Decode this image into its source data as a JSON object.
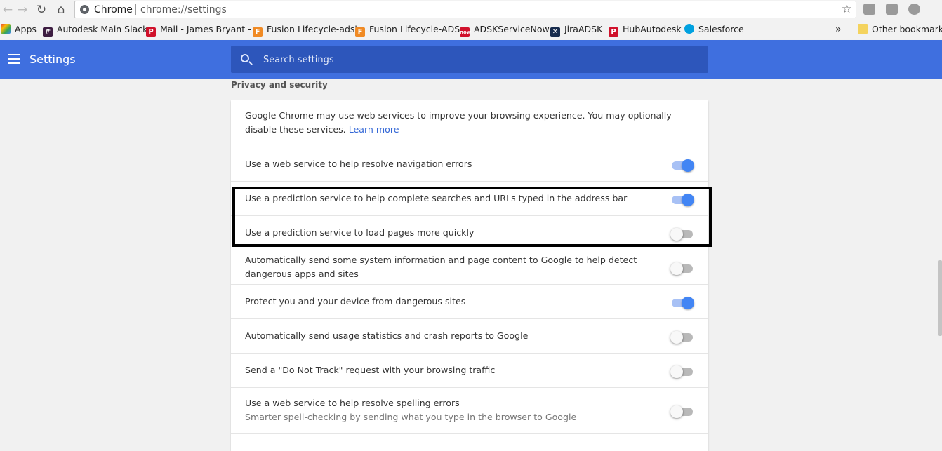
{
  "browser": {
    "origin": "Chrome",
    "url": "chrome://settings",
    "bookmarks": [
      {
        "label": "Apps",
        "icon": "apps-grid-icon",
        "color": "#e94235"
      },
      {
        "label": "Autodesk Main Slack",
        "icon": "hash-icon",
        "color": "#3d1d41"
      },
      {
        "label": "Mail - James Bryant -",
        "icon": "mail-icon",
        "color": "#d0112b"
      },
      {
        "label": "Fusion Lifecycle-adsk",
        "icon": "fusion-icon",
        "color": "#f08a24"
      },
      {
        "label": "Fusion Lifecycle-ADS",
        "icon": "fusion-icon",
        "color": "#f08a24"
      },
      {
        "label": "ADSKServiceNow",
        "icon": "now-icon",
        "color": "#d0112b"
      },
      {
        "label": "JiraADSK",
        "icon": "jira-icon",
        "color": "#172b4d"
      },
      {
        "label": "HubAutodesk",
        "icon": "hub-icon",
        "color": "#d0112b"
      },
      {
        "label": "Salesforce",
        "icon": "cloud-icon",
        "color": "#00a1e0"
      }
    ],
    "overflow": "»",
    "other_bookmarks": "Other bookmarks"
  },
  "settings": {
    "title": "Settings",
    "search_placeholder": "Search settings",
    "section_title": "Privacy and security",
    "intro_text": "Google Chrome may use web services to improve your browsing experience. You may optionally disable these services.",
    "learn_more": "Learn more",
    "items": [
      {
        "label": "Use a web service to help resolve navigation errors",
        "subtext": "",
        "enabled": true
      },
      {
        "label": "Use a prediction service to help complete searches and URLs typed in the address bar",
        "subtext": "",
        "enabled": true
      },
      {
        "label": "Use a prediction service to load pages more quickly",
        "subtext": "",
        "enabled": false
      },
      {
        "label": "Automatically send some system information and page content to Google to help detect dangerous apps and sites",
        "subtext": "",
        "enabled": false
      },
      {
        "label": "Protect you and your device from dangerous sites",
        "subtext": "",
        "enabled": true
      },
      {
        "label": "Automatically send usage statistics and crash reports to Google",
        "subtext": "",
        "enabled": false
      },
      {
        "label": "Send a \"Do Not Track\" request with your browsing traffic",
        "subtext": "",
        "enabled": false
      },
      {
        "label": "Use a web service to help resolve spelling errors",
        "subtext": "Smarter spell-checking by sending what you type in the browser to Google",
        "enabled": false
      }
    ]
  },
  "colors": {
    "accent": "#3f6fdf",
    "search_background": "#2d56bb",
    "toggle_on": "#4285f4",
    "link": "#3367d6"
  }
}
